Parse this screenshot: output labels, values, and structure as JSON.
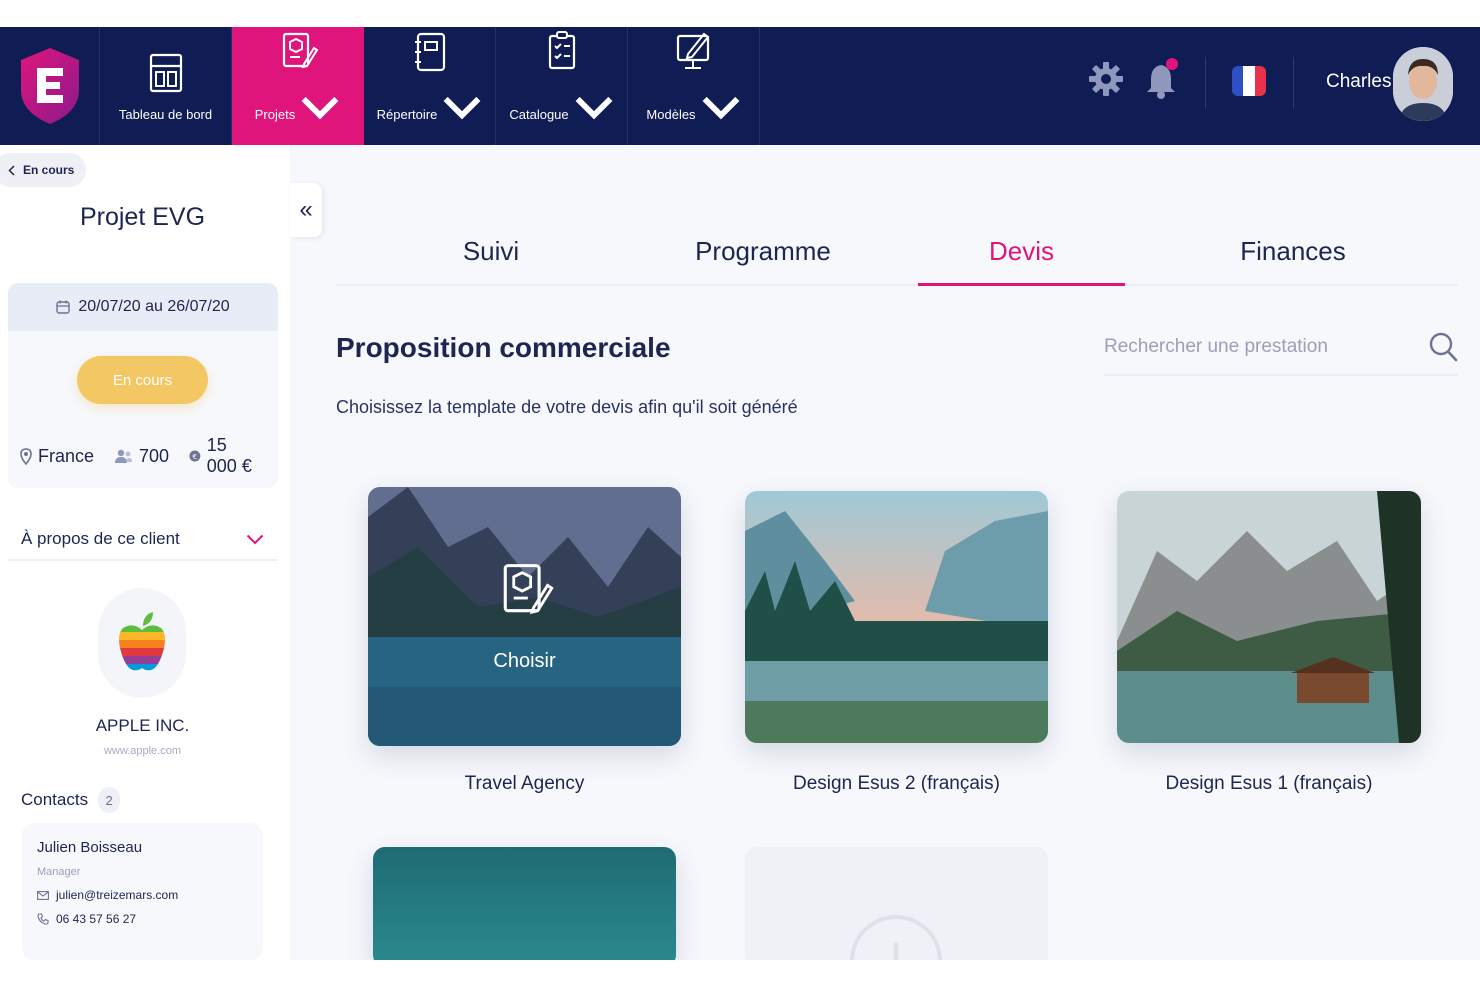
{
  "nav": {
    "items": [
      {
        "label": "Tableau de bord",
        "icon": "dashboard-icon",
        "active": false,
        "dropdown": false
      },
      {
        "label": "Projets",
        "icon": "projects-icon",
        "active": true,
        "dropdown": true
      },
      {
        "label": "Répertoire",
        "icon": "directory-icon",
        "active": false,
        "dropdown": true
      },
      {
        "label": "Catalogue",
        "icon": "catalogue-icon",
        "active": false,
        "dropdown": true
      },
      {
        "label": "Modèles",
        "icon": "templates-icon",
        "active": false,
        "dropdown": true
      }
    ],
    "user_name": "Charles",
    "brand_color": "#e0157b",
    "navy_color": "#101c54"
  },
  "sidebar": {
    "back_label": "En cours",
    "project_title": "Projet EVG",
    "dates": "20/07/20 au 26/07/20",
    "status": "En cours",
    "status_color": "#f3c864",
    "location": "France",
    "attendees": "700",
    "budget": "15 000 €",
    "about_label": "À propos de ce client",
    "client_name": "APPLE INC.",
    "client_website": "www.apple.com",
    "contacts_label": "Contacts",
    "contacts_count": "2",
    "contact": {
      "name": "Julien Boisseau",
      "role": "Manager",
      "email": "julien@treizemars.com",
      "phone": "06 43 57 56 27"
    }
  },
  "tabs": [
    {
      "label": "Suivi",
      "active": false
    },
    {
      "label": "Programme",
      "active": false
    },
    {
      "label": "Devis",
      "active": true
    },
    {
      "label": "Finances",
      "active": false
    }
  ],
  "main": {
    "title": "Proposition commerciale",
    "subtitle": "Choisissez la template de votre devis afin qu'il soit généré",
    "search_placeholder": "Rechercher une prestation",
    "choose_label": "Choisir",
    "templates": [
      {
        "name": "Travel Agency",
        "hovered": true
      },
      {
        "name": "Design Esus 2 (français)",
        "hovered": false
      },
      {
        "name": "Design Esus 1 (français)",
        "hovered": false
      }
    ]
  }
}
